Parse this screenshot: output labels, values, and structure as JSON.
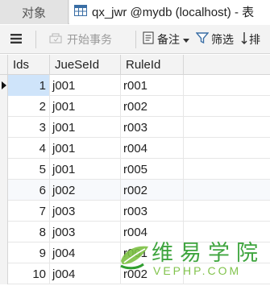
{
  "tabs": [
    {
      "label": "对象",
      "active": false
    },
    {
      "label": "qx_jwr @mydb (localhost) - 表",
      "active": true
    }
  ],
  "toolbar": {
    "menu_icon": "hamburger-menu-icon",
    "begin_transaction": "开始事务",
    "memo": "备注",
    "filter": "筛选",
    "sort": "排"
  },
  "columns": [
    "Ids",
    "JueSeId",
    "RuleId"
  ],
  "rows": [
    {
      "ids": "1",
      "jueseid": "j001",
      "ruleid": "r001",
      "selected": true
    },
    {
      "ids": "2",
      "jueseid": "j001",
      "ruleid": "r002"
    },
    {
      "ids": "3",
      "jueseid": "j001",
      "ruleid": "r003"
    },
    {
      "ids": "4",
      "jueseid": "j001",
      "ruleid": "r004"
    },
    {
      "ids": "5",
      "jueseid": "j001",
      "ruleid": "r005"
    },
    {
      "ids": "6",
      "jueseid": "j002",
      "ruleid": "r002"
    },
    {
      "ids": "7",
      "jueseid": "j003",
      "ruleid": "r003"
    },
    {
      "ids": "8",
      "jueseid": "j003",
      "ruleid": "r004"
    },
    {
      "ids": "9",
      "jueseid": "j004",
      "ruleid": "r001"
    },
    {
      "ids": "10",
      "jueseid": "j004",
      "ruleid": "r002"
    }
  ],
  "watermark": {
    "cn": "维易学院",
    "en": "VEPHP.COM"
  },
  "colors": {
    "selected_cell": "#cfe4fa",
    "watermark_green": "#2f9e2f"
  }
}
